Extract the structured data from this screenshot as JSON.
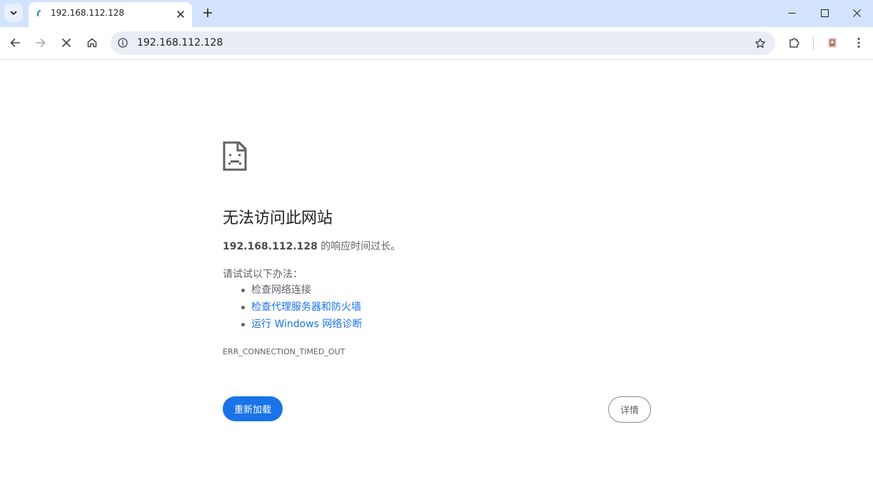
{
  "tab": {
    "title": "192.168.112.128"
  },
  "toolbar": {
    "url": "192.168.112.128"
  },
  "error": {
    "title": "无法访问此网站",
    "host": "192.168.112.128",
    "description_suffix": " 的响应时间过长。",
    "suggestions_heading": "请试试以下办法：",
    "suggestions": [
      {
        "label": "检查网络连接",
        "link": false
      },
      {
        "label": "检查代理服务器和防火墙",
        "link": true
      },
      {
        "label": "运行 Windows 网络诊断",
        "link": true
      }
    ],
    "code": "ERR_CONNECTION_TIMED_OUT",
    "reload_label": "重新加载",
    "details_label": "详情"
  },
  "colors": {
    "tabstrip": "#d3e3fd",
    "omnibox": "#e9eef6",
    "accent": "#1a73e8",
    "text_secondary": "#5f6368"
  },
  "icons": {
    "tab_search": "chevron-down-icon",
    "tab_loading": "spinner-icon",
    "tab_close": "close-icon",
    "new_tab": "plus-icon",
    "back": "arrow-left-icon",
    "forward": "arrow-right-icon",
    "stop": "close-icon",
    "home": "home-icon",
    "site_info": "info-icon",
    "bookmark": "star-icon",
    "extensions": "puzzle-icon",
    "profile": "avatar-icon",
    "menu": "kebab-menu-icon",
    "error_page": "sad-document-icon"
  }
}
